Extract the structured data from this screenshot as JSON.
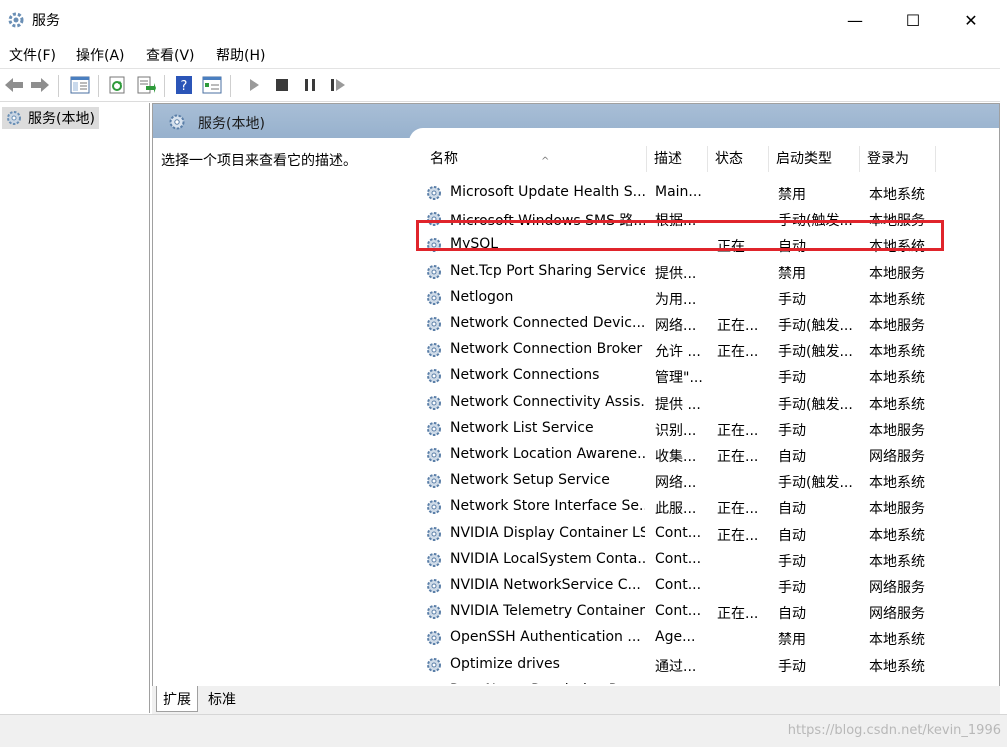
{
  "window": {
    "title": "服务",
    "minimize": "—",
    "maximize": "☐",
    "close": "✕"
  },
  "menu": [
    "文件(F)",
    "操作(A)",
    "查看(V)",
    "帮助(H)"
  ],
  "tree": {
    "root_label": "服务(本地)"
  },
  "header": {
    "title": "服务(本地)"
  },
  "description_prompt": "选择一个项目来查看它的描述。",
  "columns": [
    "名称",
    "描述",
    "状态",
    "启动类型",
    "登录为"
  ],
  "services": [
    {
      "name": "Microsoft Update Health S...",
      "desc": "Main...",
      "status": "",
      "start": "禁用",
      "login": "本地系统"
    },
    {
      "name": "Microsoft Windows SMS 路...",
      "desc": "根据...",
      "status": "",
      "start": "手动(触发...",
      "login": "本地服务"
    },
    {
      "name": "MySQL",
      "desc": "",
      "status": "正在...",
      "start": "自动",
      "login": "本地系统"
    },
    {
      "name": "Net.Tcp Port Sharing Service",
      "desc": "提供...",
      "status": "",
      "start": "禁用",
      "login": "本地服务"
    },
    {
      "name": "Netlogon",
      "desc": "为用...",
      "status": "",
      "start": "手动",
      "login": "本地系统"
    },
    {
      "name": "Network Connected Devic...",
      "desc": "网络...",
      "status": "正在...",
      "start": "手动(触发...",
      "login": "本地服务"
    },
    {
      "name": "Network Connection Broker",
      "desc": "允许 ...",
      "status": "正在...",
      "start": "手动(触发...",
      "login": "本地系统"
    },
    {
      "name": "Network Connections",
      "desc": "管理\"...",
      "status": "",
      "start": "手动",
      "login": "本地系统"
    },
    {
      "name": "Network Connectivity Assis...",
      "desc": "提供 ...",
      "status": "",
      "start": "手动(触发...",
      "login": "本地系统"
    },
    {
      "name": "Network List Service",
      "desc": "识别...",
      "status": "正在...",
      "start": "手动",
      "login": "本地服务"
    },
    {
      "name": "Network Location Awarene...",
      "desc": "收集...",
      "status": "正在...",
      "start": "自动",
      "login": "网络服务"
    },
    {
      "name": "Network Setup Service",
      "desc": "网络...",
      "status": "",
      "start": "手动(触发...",
      "login": "本地系统"
    },
    {
      "name": "Network Store Interface Se...",
      "desc": "此服...",
      "status": "正在...",
      "start": "自动",
      "login": "本地服务"
    },
    {
      "name": "NVIDIA Display Container LS",
      "desc": "Cont...",
      "status": "正在...",
      "start": "自动",
      "login": "本地系统"
    },
    {
      "name": "NVIDIA LocalSystem Conta...",
      "desc": "Cont...",
      "status": "",
      "start": "手动",
      "login": "本地系统"
    },
    {
      "name": "NVIDIA NetworkService C...",
      "desc": "Cont...",
      "status": "",
      "start": "手动",
      "login": "网络服务"
    },
    {
      "name": "NVIDIA Telemetry Container",
      "desc": "Cont...",
      "status": "正在...",
      "start": "自动",
      "login": "网络服务"
    },
    {
      "name": "OpenSSH Authentication ...",
      "desc": "Age...",
      "status": "",
      "start": "禁用",
      "login": "本地系统"
    },
    {
      "name": "Optimize drives",
      "desc": "通过...",
      "status": "",
      "start": "手动",
      "login": "本地系统"
    },
    {
      "name": "Peer Name Resolution Pro...",
      "desc": "使用...",
      "status": "",
      "start": "手动",
      "login": "本地服务"
    }
  ],
  "highlighted_service": "MySQL",
  "tabs": [
    "扩展",
    "标准"
  ],
  "watermark": "https://blog.csdn.net/kevin_1996",
  "colors": {
    "header_bg": "#a8bed6",
    "highlight_border": "#e0242b",
    "icon_blue": "#2d6fb7"
  },
  "icons": {
    "toolbar": [
      "back-arrow-icon",
      "forward-arrow-icon",
      "console-tree-icon",
      "refresh-icon",
      "export-list-icon",
      "help-icon",
      "properties-icon",
      "play-icon",
      "stop-icon",
      "pause-icon",
      "resume-icon"
    ],
    "service": "gear-icon"
  }
}
